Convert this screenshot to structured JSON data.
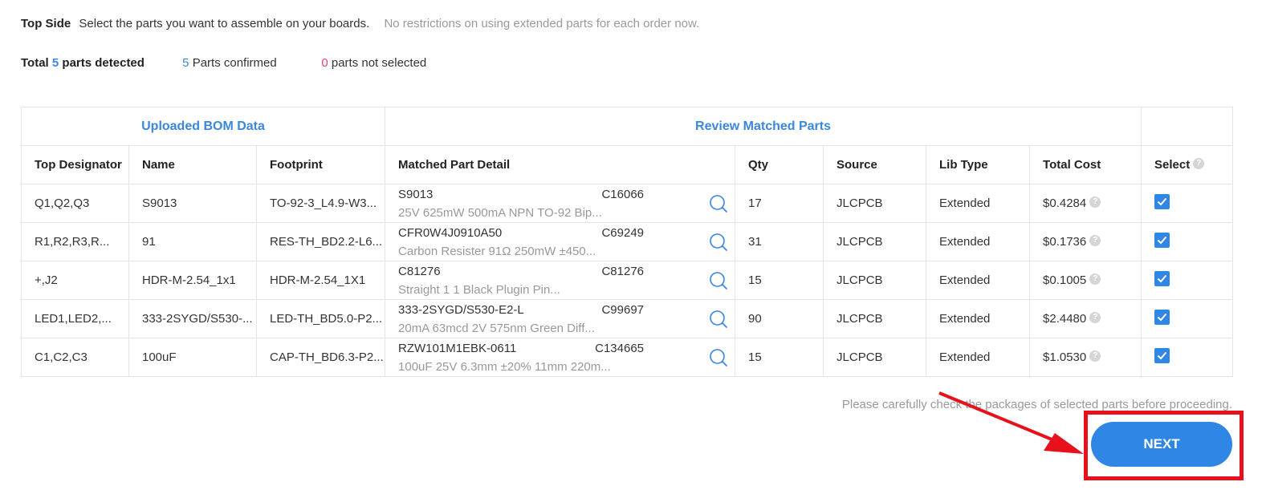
{
  "header": {
    "side": "Top Side",
    "description": "Select the parts you want to assemble on your boards.",
    "note": "No restrictions on using extended parts for each order now."
  },
  "summary": {
    "total_prefix": "Total",
    "total_count": "5",
    "total_suffix": "parts detected",
    "confirmed_count": "5",
    "confirmed_label": "Parts confirmed",
    "not_selected_count": "0",
    "not_selected_label": "parts not selected"
  },
  "table": {
    "group_uploaded": "Uploaded BOM Data",
    "group_review": "Review Matched Parts",
    "columns": {
      "designator": "Top Designator",
      "name": "Name",
      "footprint": "Footprint",
      "detail": "Matched Part Detail",
      "qty": "Qty",
      "source": "Source",
      "lib_type": "Lib Type",
      "total_cost": "Total Cost",
      "select": "Select"
    },
    "rows": [
      {
        "designator": "Q1,Q2,Q3",
        "name": "S9013",
        "footprint": "TO-92-3_L4.9-W3...",
        "part": "S9013",
        "code": "C16066",
        "desc": "25V 625mW 500mA NPN TO-92 Bip...",
        "qty": "17",
        "source": "JLCPCB",
        "lib_type": "Extended",
        "cost": "$0.4284"
      },
      {
        "designator": "R1,R2,R3,R...",
        "name": "91",
        "footprint": "RES-TH_BD2.2-L6...",
        "part": "CFR0W4J0910A50",
        "code": "C69249",
        "desc": "Carbon Resister 91Ω 250mW ±450...",
        "qty": "31",
        "source": "JLCPCB",
        "lib_type": "Extended",
        "cost": "$0.1736"
      },
      {
        "designator": "+,J2",
        "name": "HDR-M-2.54_1x1",
        "footprint": "HDR-M-2.54_1X1",
        "part": "C81276",
        "code": "C81276",
        "desc": "Straight 1 1 Black Plugin Pin...",
        "qty": "15",
        "source": "JLCPCB",
        "lib_type": "Extended",
        "cost": "$0.1005"
      },
      {
        "designator": "LED1,LED2,...",
        "name": "333-2SYGD/S530-...",
        "footprint": "LED-TH_BD5.0-P2...",
        "part": "333-2SYGD/S530-E2-L",
        "code": "C99697",
        "desc": "20mA 63mcd 2V 575nm Green Diff...",
        "qty": "90",
        "source": "JLCPCB",
        "lib_type": "Extended",
        "cost": "$2.4480"
      },
      {
        "designator": "C1,C2,C3",
        "name": "100uF",
        "footprint": "CAP-TH_BD6.3-P2...",
        "part": "RZW101M1EBK-0611",
        "code": "C134665",
        "desc": "100uF 25V 6.3mm ±20% 11mm 220m...",
        "qty": "15",
        "source": "JLCPCB",
        "lib_type": "Extended",
        "cost": "$1.0530"
      }
    ]
  },
  "footer": {
    "note": "Please carefully check the packages of selected parts before proceeding.",
    "next_label": "NEXT"
  },
  "colors": {
    "accent": "#2f86e4",
    "link_blue": "#3a87e0",
    "pink": "#e2436d",
    "annotation_red": "#e8101a"
  }
}
